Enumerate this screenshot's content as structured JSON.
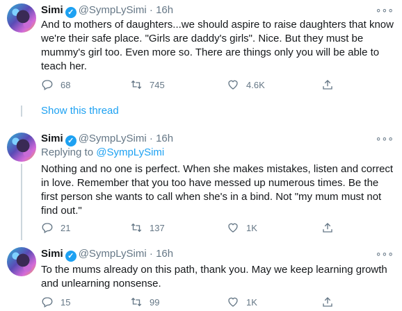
{
  "colors": {
    "accent": "#1da1f2",
    "secondary_text": "#657786",
    "text": "#14171a",
    "line": "#ccd6dd"
  },
  "tweets": [
    {
      "name": "Simi",
      "handle": "@SympLySimi",
      "dot": "·",
      "time": "16h",
      "replying_prefix": "",
      "replying_handle": "",
      "text": "And to mothers of daughters...we should aspire to raise daughters that know we're their safe place. \"Girls are daddy's girls\". Nice. But they must be mummy's girl too. Even more so. There are things only you will be able to teach her.",
      "replies": "68",
      "retweets": "745",
      "likes": "4.6K"
    },
    {
      "name": "Simi",
      "handle": "@SympLySimi",
      "dot": "·",
      "time": "16h",
      "replying_prefix": "Replying to ",
      "replying_handle": "@SympLySimi",
      "text": "Nothing and no one is perfect. When she makes mistakes, listen and correct in love. Remember that you too have messed up numerous times. Be the first person she wants to call when she's in a bind. Not \"my mum must not find out.\"",
      "replies": "21",
      "retweets": "137",
      "likes": "1K"
    },
    {
      "name": "Simi",
      "handle": "@SympLySimi",
      "dot": "·",
      "time": "16h",
      "replying_prefix": "",
      "replying_handle": "",
      "text": "To the mums already on this path, thank you. May we keep learning growth and unlearning nonsense.",
      "replies": "15",
      "retweets": "99",
      "likes": "1K"
    }
  ],
  "show_thread": "Show this thread",
  "icons": {
    "verified": "verified-badge-icon",
    "more": "more-options-icon",
    "reply": "reply-icon",
    "retweet": "retweet-icon",
    "like": "heart-icon",
    "share": "share-icon"
  }
}
